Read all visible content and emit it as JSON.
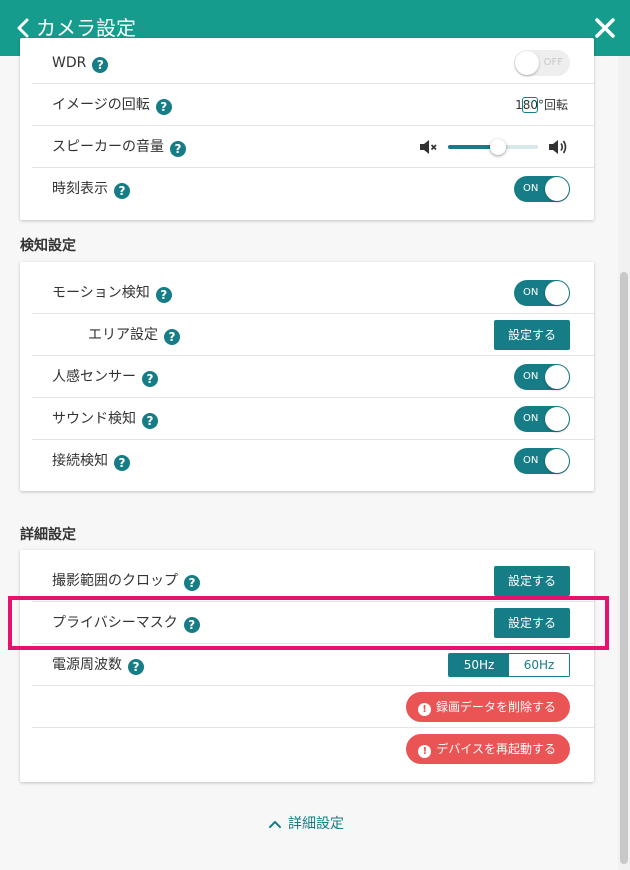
{
  "header": {
    "title": "カメラ設定",
    "back_icon": "chevron-left-icon",
    "close_icon": "close-icon"
  },
  "colors": {
    "header": "#169c8c",
    "accent": "#167d86",
    "danger": "#ea5455",
    "highlight": "#e8126e"
  },
  "camera_section": {
    "rows": [
      {
        "label": "WDR",
        "control": "toggle",
        "state": "OFF"
      },
      {
        "label": "イメージの回転",
        "control": "checkbox",
        "checkbox_label": "180°回転",
        "checked": false
      },
      {
        "label": "スピーカーの音量",
        "control": "slider",
        "volume": 0.55
      },
      {
        "label": "時刻表示",
        "control": "toggle",
        "state": "ON"
      }
    ]
  },
  "detection_section": {
    "title": "検知設定",
    "rows": [
      {
        "label": "モーション検知",
        "state": "ON"
      },
      {
        "label": "エリア設定",
        "button": "設定する"
      },
      {
        "label": "人感センサー",
        "state": "ON"
      },
      {
        "label": "サウンド検知",
        "state": "ON"
      },
      {
        "label": "接続検知",
        "state": "ON"
      }
    ]
  },
  "advanced_section": {
    "title": "詳細設定",
    "rows": [
      {
        "label": "撮影範囲のクロップ",
        "button": "設定する"
      },
      {
        "label": "プライバシーマスク",
        "button": "設定する"
      },
      {
        "label": "電源周波数",
        "options": [
          "50Hz",
          "60Hz"
        ],
        "selected": "50Hz"
      }
    ],
    "delete_recordings": "録画データを削除する",
    "restart_device": "デバイスを再起動する"
  },
  "footer": {
    "collapse_label": "詳細設定"
  },
  "help_glyph": "?",
  "danger_glyph": "!"
}
